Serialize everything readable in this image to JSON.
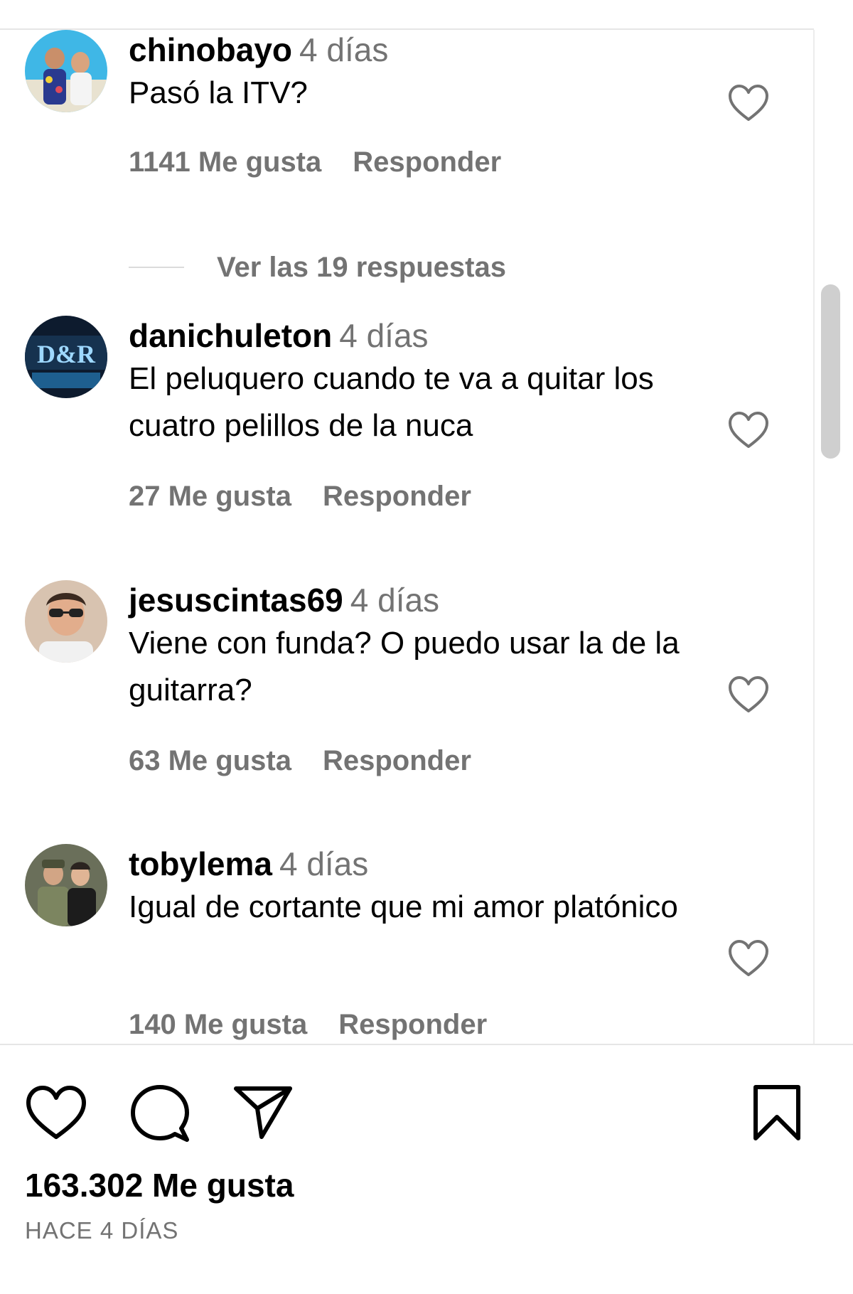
{
  "comments": [
    {
      "username": "chinobayo",
      "time": "4 días",
      "text": "Pasó la ITV?",
      "likes": "1141 Me gusta",
      "reply_label": "Responder",
      "avatar_icon": "avatar-beach-couple"
    },
    {
      "username": "danichuleton",
      "time": "4 días",
      "text": "El peluquero cuando te va a quitar los cuatro pelillos de la nuca",
      "likes": "27 Me gusta",
      "reply_label": "Responder",
      "avatar_icon": "avatar-neon-sign"
    },
    {
      "username": "jesuscintas69",
      "time": "4 días",
      "text": "Viene con funda? O puedo usar la de la guitarra?",
      "likes": "63 Me gusta",
      "reply_label": "Responder",
      "avatar_icon": "avatar-man-sunglasses"
    },
    {
      "username": "tobylema",
      "time": "4 días",
      "text": "Igual de cortante que mi amor platónico",
      "likes": "140 Me gusta",
      "reply_label": "Responder",
      "avatar_icon": "avatar-two-men"
    }
  ],
  "replies_toggle": "Ver las 19 respuestas",
  "post": {
    "likes_total": "163.302 Me gusta",
    "date": "HACE 4 DÍAS"
  },
  "icons": {
    "like": "heart-icon",
    "comment": "comment-bubble-icon",
    "share": "paper-plane-icon",
    "save": "bookmark-icon"
  },
  "colors": {
    "text_primary": "#000000",
    "text_secondary": "#737373",
    "divider": "#dbdbdb"
  }
}
